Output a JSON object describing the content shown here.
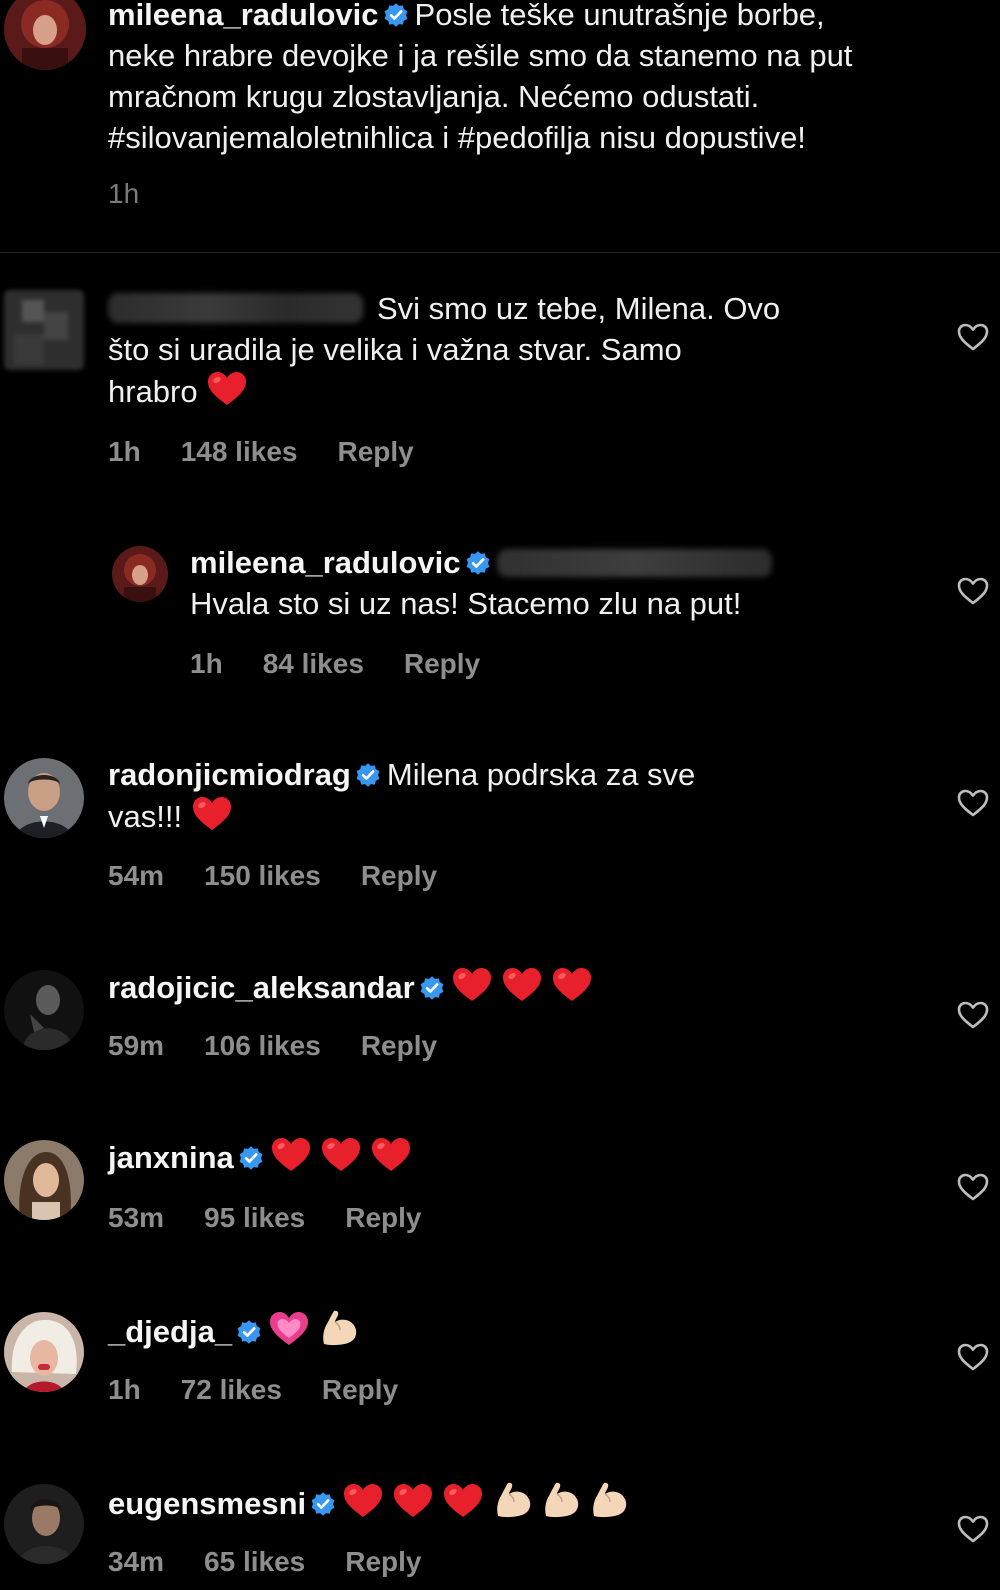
{
  "caption": {
    "username": "mileena_radulovic",
    "text": "Posle teške unutrašnje borbe, neke hrabre devojke i ja rešile smo da stanemo na put mračnom krugu zlostavljanja. Nećemo odustati. #silovanjemaloletnihlica i #pedofilja nisu dopustive!",
    "line1": "Posle teške unutrašnje borbe,",
    "line2": "neke hrabre devojke i ja rešile smo da stanemo na put",
    "line3": "mračnom krugu zlostavljanja. Nećemo odustati.",
    "line4": "#silovanjemaloletnihlica i #pedofilja nisu dopustive!",
    "time": "1h"
  },
  "comments": [
    {
      "username": "",
      "line1": "Svi smo uz tebe, Milena. Ovo",
      "line2": "što si uradila je velika i važna stvar. Samo",
      "line3": "hrabro",
      "emojis": [
        "red-heart"
      ],
      "time": "1h",
      "likes": "148 likes",
      "reply": "Reply"
    },
    {
      "username": "mileena_radulovic",
      "line1": "Hvala sto si uz nas! Stacemo zlu na put!",
      "time": "1h",
      "likes": "84 likes",
      "reply": "Reply"
    },
    {
      "username": "radonjicmiodrag",
      "line1": "Milena podrska za sve",
      "line2": "vas!!!",
      "emojis": [
        "red-heart"
      ],
      "time": "54m",
      "likes": "150 likes",
      "reply": "Reply"
    },
    {
      "username": "radojicic_aleksandar",
      "emojis": [
        "red-heart",
        "red-heart",
        "red-heart"
      ],
      "time": "59m",
      "likes": "106 likes",
      "reply": "Reply"
    },
    {
      "username": "janxnina",
      "emojis": [
        "red-heart",
        "red-heart",
        "red-heart"
      ],
      "time": "53m",
      "likes": "95 likes",
      "reply": "Reply"
    },
    {
      "username": "_djedja_",
      "emojis": [
        "growing-heart",
        "flexed-biceps"
      ],
      "time": "1h",
      "likes": "72 likes",
      "reply": "Reply"
    },
    {
      "username": "eugensmesni",
      "emojis": [
        "red-heart",
        "red-heart",
        "red-heart",
        "flexed-biceps",
        "flexed-biceps",
        "flexed-biceps"
      ],
      "time": "34m",
      "likes": "65 likes",
      "reply": "Reply"
    }
  ],
  "colors": {
    "background": "#000000",
    "text": "#f0f0f0",
    "meta": "#8e8e8e",
    "verified": "#3897f0",
    "heart": "#e8202c"
  },
  "icons": {
    "verified": "verified-badge-icon",
    "like": "heart-outline-icon"
  }
}
